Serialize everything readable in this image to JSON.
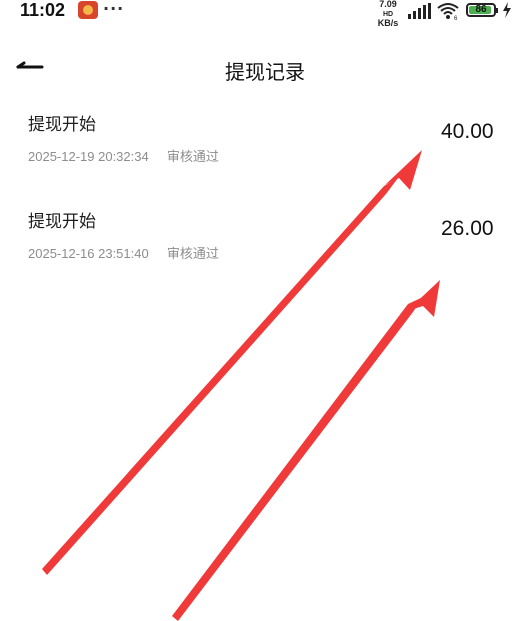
{
  "status_bar": {
    "time": "11:02",
    "dots": "···",
    "net_speed_value": "7.09",
    "net_speed_unit": "KB/s",
    "net_type": "HD",
    "wifi_label": "6",
    "battery": "86",
    "icons": [
      "app-notification-icon",
      "signal-icon",
      "wifi-icon",
      "battery-icon",
      "charging-icon"
    ]
  },
  "header": {
    "title": "提现记录",
    "back_icon": "back-arrow-icon"
  },
  "records": [
    {
      "title": "提现开始",
      "date": "2025-12-19 20:32:34",
      "status": "审核通过",
      "amount": "40.00"
    },
    {
      "title": "提现开始",
      "date": "2025-12-16 23:51:40",
      "status": "审核通过",
      "amount": "26.00"
    }
  ],
  "annotation": {
    "arrow_color": "#f03a3a",
    "arrow_count": 2
  }
}
